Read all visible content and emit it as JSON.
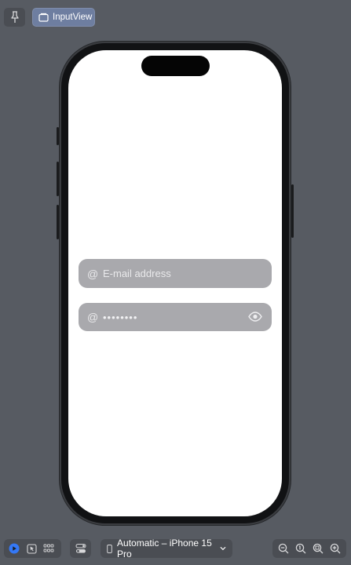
{
  "toolbar": {
    "pin_icon": "pin-icon",
    "preview_title": "InputView"
  },
  "device": {
    "selector_label": "Automatic – iPhone 15 Pro"
  },
  "form": {
    "email": {
      "symbol": "@",
      "placeholder": "E-mail address",
      "value": ""
    },
    "password": {
      "symbol": "@",
      "masked_value": "••••••••",
      "visibility_icon": "eye-icon"
    }
  },
  "colors": {
    "canvas": "#575b62",
    "field_bg": "#a9a9ad",
    "accent": "#3478f6"
  }
}
